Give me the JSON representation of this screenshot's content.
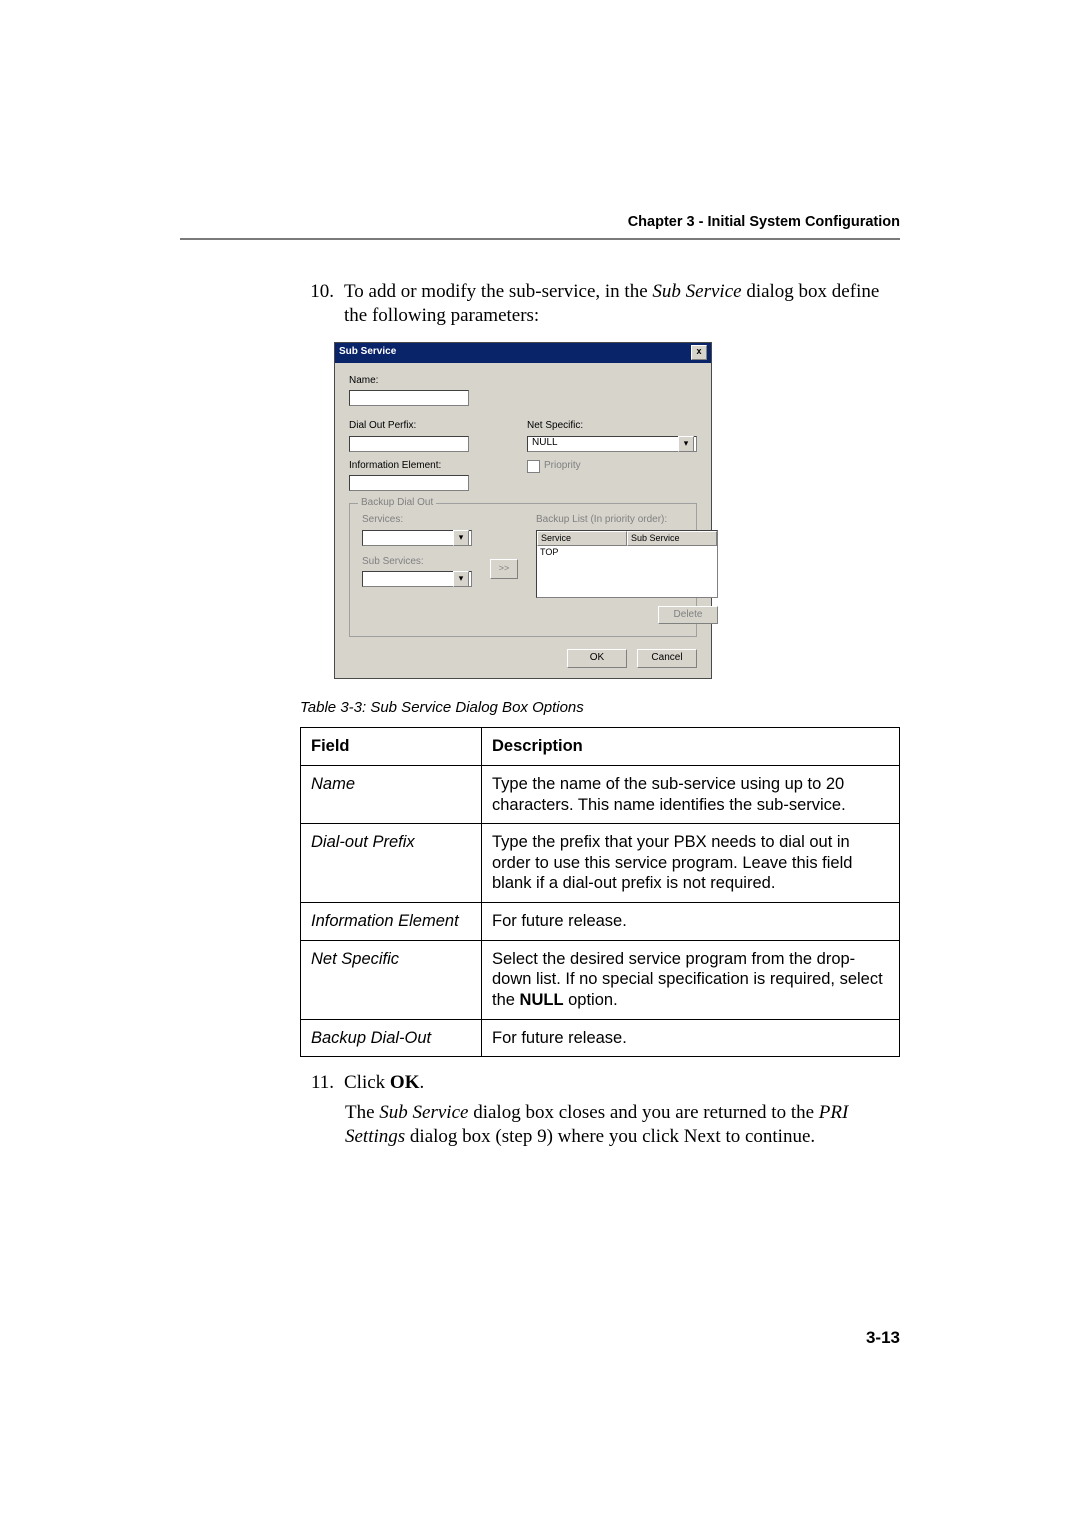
{
  "header": {
    "chapter": "Chapter 3 - Initial System Configuration"
  },
  "step10": {
    "num": "10.",
    "pre": "To add or modify the sub-service, in the ",
    "em": "Sub Service",
    "post": " dialog box define the following parameters:"
  },
  "dialog": {
    "title": "Sub Service",
    "close": "x",
    "name_label": "Name:",
    "dial_out_prefix_label": "Dial Out Perfix:",
    "info_element_label": "Information Element:",
    "net_specific_label": "Net Specific:",
    "net_specific_value": "NULL",
    "priority_label": "Prioprity",
    "group_title": "Backup Dial Out",
    "services_label": "Services:",
    "sub_services_label": "Sub Services:",
    "move_btn": ">>",
    "backup_list_label": "Backup List (In priority order):",
    "col_service": "Service",
    "col_sub_service": "Sub Service",
    "row_top": "TOP",
    "delete_btn": "Delete",
    "ok_btn": "OK",
    "cancel_btn": "Cancel"
  },
  "caption": "Table 3-3: Sub Service Dialog Box Options",
  "table": {
    "h1": "Field",
    "h2": "Description",
    "rows": [
      {
        "f": "Name",
        "d": "Type the name of the sub-service using up to 20 characters. This name identifies the sub-service."
      },
      {
        "f": "Dial-out Prefix",
        "d": "Type the prefix that your PBX needs to dial out in order to use this service program. Leave this field blank if a dial-out prefix is not required."
      },
      {
        "f": "Information Element",
        "d": "For future release."
      },
      {
        "f": "Net Specific",
        "d_pre": "Select the desired service program from the drop-down list. If no special specification is required, select the ",
        "d_bold": "NULL",
        "d_post": " option."
      },
      {
        "f": "Backup Dial-Out",
        "d": "For future release."
      }
    ]
  },
  "step11": {
    "num": "11.",
    "pre": "Click ",
    "bold": "OK",
    "post": ".",
    "line2_pre": "The ",
    "line2_em1": "Sub Service",
    "line2_mid": " dialog box closes and you are returned to the ",
    "line2_em2": "PRI Settings",
    "line2_post": " dialog box (step 9) where you click Next to continue."
  },
  "pagenum": "3-13"
}
